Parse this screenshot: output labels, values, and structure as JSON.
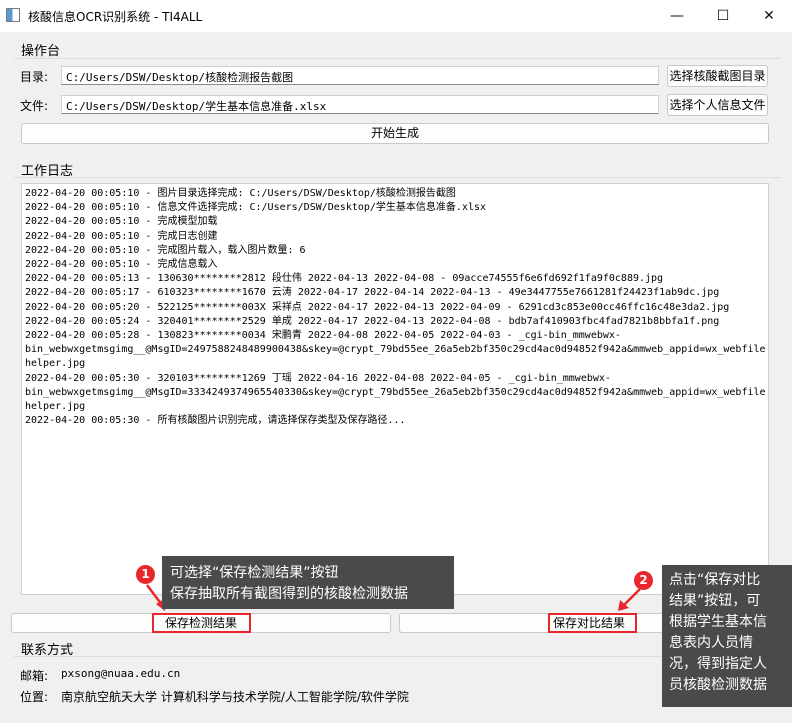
{
  "window": {
    "title": "核酸信息OCR识别系统 - TI4ALL",
    "minimize": "—",
    "maximize": "☐",
    "close": "✕"
  },
  "workbench": {
    "title": "操作台",
    "dir_label": "目录:",
    "dir_value": "C:/Users/DSW/Desktop/核酸检测报告截图",
    "dir_button": "选择核酸截图目录",
    "file_label": "文件:",
    "file_value": "C:/Users/DSW/Desktop/学生基本信息准备.xlsx",
    "file_button": "选择个人信息文件",
    "generate_button": "开始生成"
  },
  "log": {
    "title": "工作日志",
    "lines": [
      "2022-04-20 00:05:10 - 图片目录选择完成: C:/Users/DSW/Desktop/核酸检测报告截图",
      "2022-04-20 00:05:10 - 信息文件选择完成: C:/Users/DSW/Desktop/学生基本信息准备.xlsx",
      "2022-04-20 00:05:10 - 完成模型加载",
      "2022-04-20 00:05:10 - 完成日志创建",
      "2022-04-20 00:05:10 - 完成图片载入，载入图片数量: 6",
      "2022-04-20 00:05:10 - 完成信息载入",
      "2022-04-20 00:05:13 - 130630********2812 段仕伟 2022-04-13 2022-04-08 - 09acce74555f6e6fd692f1fa9f0c889.jpg",
      "2022-04-20 00:05:17 - 610323********1670 云涛 2022-04-17 2022-04-14 2022-04-13 - 49e3447755e7661281f24423f1ab9dc.jpg",
      "2022-04-20 00:05:20 - 522125********003X 采祥点 2022-04-17 2022-04-13 2022-04-09 - 6291cd3c853e00cc46ffc16c48e3da2.jpg",
      "2022-04-20 00:05:24 - 320401********2529 单成 2022-04-17 2022-04-13 2022-04-08 - bdb7af410903fbc4fad7821b8bbfa1f.png",
      "2022-04-20 00:05:28 - 130823********0034 宋鹏青 2022-04-08 2022-04-05 2022-04-03 - _cgi-bin_mmwebwx-",
      "bin_webwxgetmsgimg__@MsgID=2497588248489900438&skey=@crypt_79bd55ee_26a5eb2bf350c29cd4ac0d94852f942a&mmweb_appid=wx_webfile",
      "helper.jpg",
      "2022-04-20 00:05:30 - 320103********1269 丁瑶 2022-04-16 2022-04-08 2022-04-05 - _cgi-bin_mmwebwx-",
      "bin_webwxgetmsgimg__@MsgID=3334249374965540330&skey=@crypt_79bd55ee_26a5eb2bf350c29cd4ac0d94852f942a&mmweb_appid=wx_webfile",
      "helper.jpg",
      "2022-04-20 00:05:30 - 所有核酸图片识别完成，请选择保存类型及保存路径..."
    ]
  },
  "actions": {
    "save_results": "保存检测结果",
    "save_compare": "保存对比结果"
  },
  "contact": {
    "title": "联系方式",
    "email_label": "邮箱:",
    "email_value": "pxsong@nuaa.edu.cn",
    "address_label": "位置:",
    "address_value": "南京航空航天大学 计算机科学与技术学院/人工智能学院/软件学院"
  },
  "annotations": {
    "one": {
      "number": "1",
      "line1": "可选择“保存检测结果”按钮",
      "line2": "保存抽取所有截图得到的核酸检测数据"
    },
    "two": {
      "number": "2",
      "lines": [
        "点击“保存对比",
        "结果”按钮，可",
        "根据学生基本信",
        "息表内人员情",
        "况，得到指定人",
        "员核酸检测数据"
      ]
    },
    "highlight_color": "#e8262b"
  }
}
